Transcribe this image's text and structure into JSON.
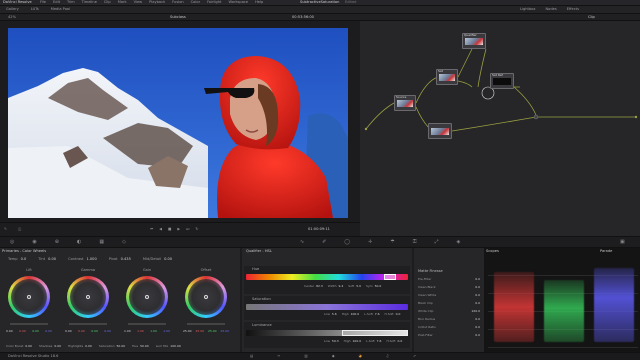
{
  "menubar": {
    "app": "DaVinci Resolve",
    "items": [
      "File",
      "Edit",
      "Trim",
      "Timeline",
      "Clip",
      "Mark",
      "View",
      "Playback",
      "Fusion",
      "Color",
      "Fairlight",
      "Workspace",
      "Help"
    ],
    "project_title": "SubtractiveSaturation",
    "project_status": "Edited"
  },
  "toolbar": {
    "left": [
      "Gallery",
      "LUTs",
      "Media Pool"
    ],
    "viewer_title": "Subclass",
    "zoom": "42%",
    "right": [
      "Lightbox",
      "Nodes",
      "Effects"
    ],
    "clip_label": "Clip",
    "timecode_top": "00:53:56:00"
  },
  "viewer": {
    "timecode": "01:00:09:11"
  },
  "nodes": [
    {
      "id": "01",
      "label": "Source"
    },
    {
      "id": "02",
      "label": "Sat"
    },
    {
      "id": "03",
      "label": "Qualifier"
    },
    {
      "id": "04",
      "label": "Sat Ref"
    },
    {
      "id": "05",
      "label": ""
    }
  ],
  "palette": {
    "left_title": "Primaries - Color Wheels",
    "mid_title": "Qualifier - HSL",
    "win_title": "Window",
    "scopes_title": "Scopes",
    "scopes_mode": "Parade"
  },
  "wheels": {
    "top_params": [
      {
        "label": "Temp",
        "value": "0.0"
      },
      {
        "label": "Tint",
        "value": "0.00"
      },
      {
        "label": "Contrast",
        "value": "1.000"
      },
      {
        "label": "Pivot",
        "value": "0.435"
      },
      {
        "label": "Mid/Detail",
        "value": "0.00"
      }
    ],
    "items": [
      {
        "name": "Lift",
        "values": [
          "0.00",
          "0.00",
          "0.00",
          "0.00"
        ]
      },
      {
        "name": "Gamma",
        "values": [
          "0.00",
          "0.00",
          "0.00",
          "0.00"
        ]
      },
      {
        "name": "Gain",
        "values": [
          "1.00",
          "1.00",
          "1.00",
          "1.00"
        ]
      },
      {
        "name": "Offset",
        "values": [
          "25.00",
          "25.00",
          "25.00",
          "25.00"
        ]
      }
    ],
    "bottom_params": [
      {
        "label": "Color Boost",
        "value": "0.00"
      },
      {
        "label": "Shadows",
        "value": "0.00"
      },
      {
        "label": "Highlights",
        "value": "0.00"
      },
      {
        "label": "Saturation",
        "value": "50.00"
      },
      {
        "label": "Hue",
        "value": "50.00"
      },
      {
        "label": "Lum Mix",
        "value": "100.00"
      }
    ]
  },
  "qualifier": {
    "hue": {
      "label": "Hue",
      "values": [
        {
          "k": "Center",
          "v": "82.3"
        },
        {
          "k": "Width",
          "v": "9.4"
        },
        {
          "k": "Soft",
          "v": "5.0"
        },
        {
          "k": "Sym",
          "v": "50.0"
        }
      ]
    },
    "sat": {
      "label": "Saturation",
      "values": [
        {
          "k": "Low",
          "v": "5.6"
        },
        {
          "k": "High",
          "v": "100.0"
        },
        {
          "k": "L.Soft",
          "v": "7.6"
        },
        {
          "k": "H.Soft",
          "v": "0.0"
        }
      ]
    },
    "lum": {
      "label": "Luminance",
      "values": [
        {
          "k": "Low",
          "v": "59.3"
        },
        {
          "k": "High",
          "v": "100.0"
        },
        {
          "k": "L.Soft",
          "v": "7.6"
        },
        {
          "k": "H.Soft",
          "v": "0.0"
        }
      ]
    }
  },
  "matte": {
    "title": "Matte Finesse",
    "rows": [
      {
        "k": "Pre-Filter",
        "v": "0.0"
      },
      {
        "k": "Clean Black",
        "v": "0.0"
      },
      {
        "k": "Clean White",
        "v": "0.0"
      },
      {
        "k": "Black Clip",
        "v": "0.0"
      },
      {
        "k": "White Clip",
        "v": "100.0"
      },
      {
        "k": "Blur Radius",
        "v": "0.0"
      },
      {
        "k": "In/Out Ratio",
        "v": "0.0"
      },
      {
        "k": "Post-Filter",
        "v": "0.0"
      }
    ]
  },
  "status": {
    "app": "DaVinci Resolve Studio 18.6"
  },
  "colors": {
    "accent": "#e8a23b",
    "red": "#e23a3a",
    "green": "#36c45a",
    "blue": "#5a58e8"
  }
}
